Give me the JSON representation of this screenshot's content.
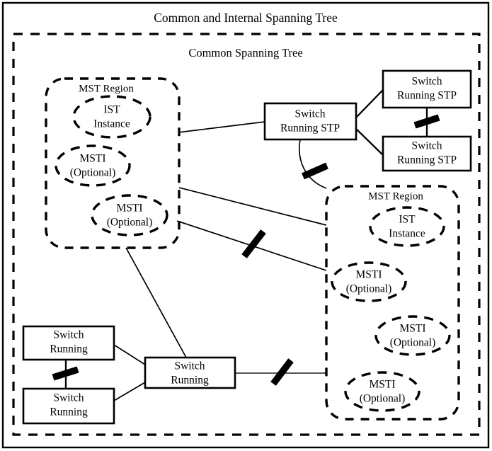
{
  "diagram": {
    "title": "Common and Internal Spanning Tree",
    "cst_frame_label": "Common Spanning Tree",
    "regions": [
      {
        "id": "mst-region-left",
        "label": "MST Region",
        "instances": [
          {
            "id": "ist-left",
            "line1": "IST",
            "line2": "Instance"
          },
          {
            "id": "msti-left-1",
            "line1": "MSTI",
            "line2": "(Optional)"
          },
          {
            "id": "msti-left-2",
            "line1": "MSTI",
            "line2": "(Optional)"
          }
        ]
      },
      {
        "id": "mst-region-right",
        "label": "MST Region",
        "instances": [
          {
            "id": "ist-right",
            "line1": "IST",
            "line2": "Instance"
          },
          {
            "id": "msti-right-1",
            "line1": "MSTI",
            "line2": "(Optional)"
          },
          {
            "id": "msti-right-2",
            "line1": "MSTI",
            "line2": "(Optional)"
          },
          {
            "id": "msti-right-3",
            "line1": "MSTI",
            "line2": "(Optional)"
          }
        ]
      }
    ],
    "switches": [
      {
        "id": "switch-stp-center",
        "line1": "Switch",
        "line2": "Running STP"
      },
      {
        "id": "switch-stp-top-right",
        "line1": "Switch",
        "line2": "Running STP"
      },
      {
        "id": "switch-stp-bottom-right",
        "line1": "Switch",
        "line2": "Running STP"
      },
      {
        "id": "switch-running-top-left",
        "line1": "Switch",
        "line2": "Running"
      },
      {
        "id": "switch-running-bottom-left",
        "line1": "Switch",
        "line2": "Running"
      },
      {
        "id": "switch-running-center",
        "line1": "Switch",
        "line2": "Running"
      }
    ],
    "blocked_links_count": 5,
    "colors": {
      "stroke": "#000000",
      "background": "#ffffff",
      "gray_link": "#555555"
    }
  }
}
